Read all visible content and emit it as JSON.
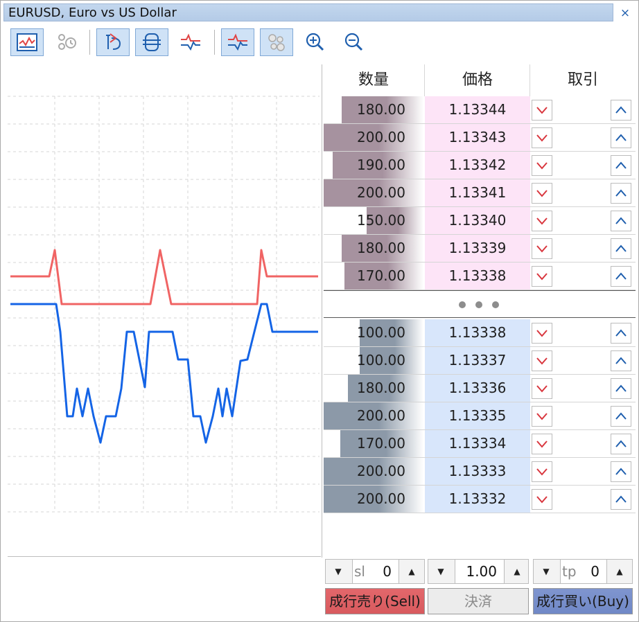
{
  "window": {
    "title": "EURUSD, Euro vs US Dollar",
    "close_glyph": "×"
  },
  "toolbar": {
    "buttons": [
      {
        "name": "chart-window-icon",
        "active": true
      },
      {
        "name": "pending-orders-icon",
        "active": false
      },
      {
        "name": "one-click-trading-icon",
        "active": true
      },
      {
        "name": "order-levels-icon",
        "active": true
      },
      {
        "name": "tick-chart-icon",
        "active": false
      },
      {
        "name": "tick-chart-active-icon",
        "active": true
      },
      {
        "name": "depth-bubbles-icon",
        "active": true
      },
      {
        "name": "zoom-in-icon",
        "active": false
      },
      {
        "name": "zoom-out-icon",
        "active": false
      }
    ]
  },
  "colors": {
    "ask_line": "#f06464",
    "bid_line": "#1464e6",
    "ask_price_bg": "#fde4f7",
    "bid_price_bg": "#d8e6fb",
    "ask_volume": "#a6929f",
    "bid_volume": "#8c99a8",
    "sell_button": "#e3676b",
    "buy_button": "#7f95cf",
    "close_button": "#ececec"
  },
  "table": {
    "headers": {
      "volume": "数量",
      "price": "価格",
      "trade": "取引"
    },
    "asks": [
      {
        "volume": "180.00",
        "price": "1.13344",
        "fill": 0.82
      },
      {
        "volume": "200.00",
        "price": "1.13343",
        "fill": 1.0
      },
      {
        "volume": "190.00",
        "price": "1.13342",
        "fill": 0.91
      },
      {
        "volume": "200.00",
        "price": "1.13341",
        "fill": 1.0
      },
      {
        "volume": "150.00",
        "price": "1.13340",
        "fill": 0.57
      },
      {
        "volume": "180.00",
        "price": "1.13339",
        "fill": 0.82
      },
      {
        "volume": "170.00",
        "price": "1.13338",
        "fill": 0.79
      }
    ],
    "bids": [
      {
        "volume": "100.00",
        "price": "1.13338",
        "fill": 0.64
      },
      {
        "volume": "100.00",
        "price": "1.13337",
        "fill": 0.64
      },
      {
        "volume": "180.00",
        "price": "1.13336",
        "fill": 0.76
      },
      {
        "volume": "200.00",
        "price": "1.13335",
        "fill": 1.0
      },
      {
        "volume": "170.00",
        "price": "1.13334",
        "fill": 0.83
      },
      {
        "volume": "200.00",
        "price": "1.13333",
        "fill": 1.0
      },
      {
        "volume": "200.00",
        "price": "1.13332",
        "fill": 1.0
      }
    ]
  },
  "controls": {
    "sl": {
      "label": "sl",
      "value": "0"
    },
    "volume": {
      "value": "1.00"
    },
    "tp": {
      "label": "tp",
      "value": "0"
    },
    "sell_label": "成行売り(Sell)",
    "close_label": "決済",
    "buy_label": "成行買い(Buy)"
  }
}
